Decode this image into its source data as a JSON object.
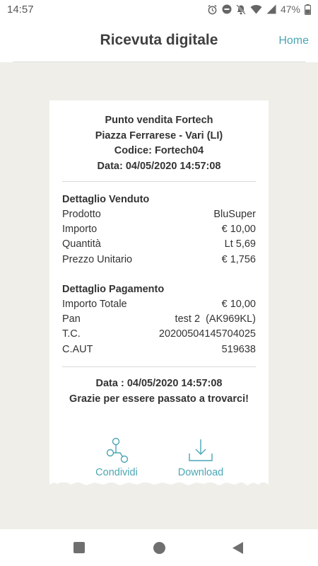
{
  "status_bar": {
    "time": "14:57",
    "battery": "47%",
    "icons": [
      "alarm-icon",
      "do-not-disturb-icon",
      "notifications-off-icon",
      "wifi-icon",
      "signal-icon",
      "battery-icon"
    ]
  },
  "header": {
    "title": "Ricevuta digitale",
    "home_label": "Home"
  },
  "receipt": {
    "shop_lines": [
      "Punto vendita Fortech",
      "Piazza Ferrarese - Vari (LI)",
      "Codice: Fortech04",
      "Data: 04/05/2020 14:57:08"
    ],
    "sold": {
      "title": "Dettaglio Venduto",
      "rows": [
        {
          "label": "Prodotto",
          "value": "BluSuper"
        },
        {
          "label": "Importo",
          "value": "€ 10,00"
        },
        {
          "label": "Quantità",
          "value": "Lt 5,69"
        },
        {
          "label": "Prezzo Unitario",
          "value": "€ 1,756"
        }
      ]
    },
    "payment": {
      "title": "Dettaglio Pagamento",
      "rows": [
        {
          "label": "Importo Totale",
          "value": "€ 10,00"
        },
        {
          "label": "Pan",
          "value": "test 2  (AK969KL)"
        },
        {
          "label": "T.C.",
          "value": "20200504145704025"
        },
        {
          "label": "C.AUT",
          "value": "519638"
        }
      ]
    },
    "footer_lines": [
      "Data : 04/05/2020 14:57:08",
      "Grazie per essere passato a trovarci!"
    ],
    "actions": {
      "share_label": "Condividi",
      "download_label": "Download"
    }
  },
  "colors": {
    "accent": "#4aa6b3",
    "background": "#efeee9",
    "title": "#404040"
  }
}
